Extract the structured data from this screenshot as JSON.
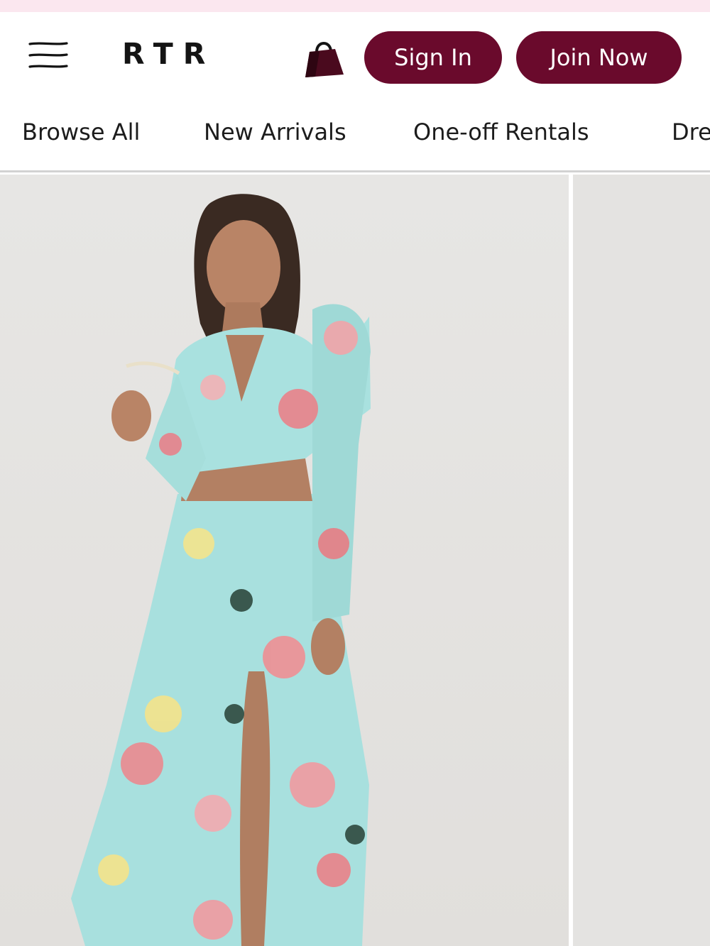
{
  "brand": {
    "logo_text": "RTR",
    "accent_color": "#6a0a2c",
    "promo_bar_color": "#fbe7ef"
  },
  "header": {
    "menu_icon": "hamburger-menu-icon",
    "bag_icon": "shopping-bag-icon",
    "sign_in_label": "Sign In",
    "join_now_label": "Join Now"
  },
  "nav": {
    "items": [
      {
        "label": "Browse All"
      },
      {
        "label": "New Arrivals"
      },
      {
        "label": "One-off Rentals"
      },
      {
        "label": "Dre"
      }
    ]
  },
  "products": [
    {
      "image": "model-in-floral-aqua-crop-top-and-maxi-skirt"
    },
    {
      "image": "next-product-image-partially-visible"
    }
  ]
}
